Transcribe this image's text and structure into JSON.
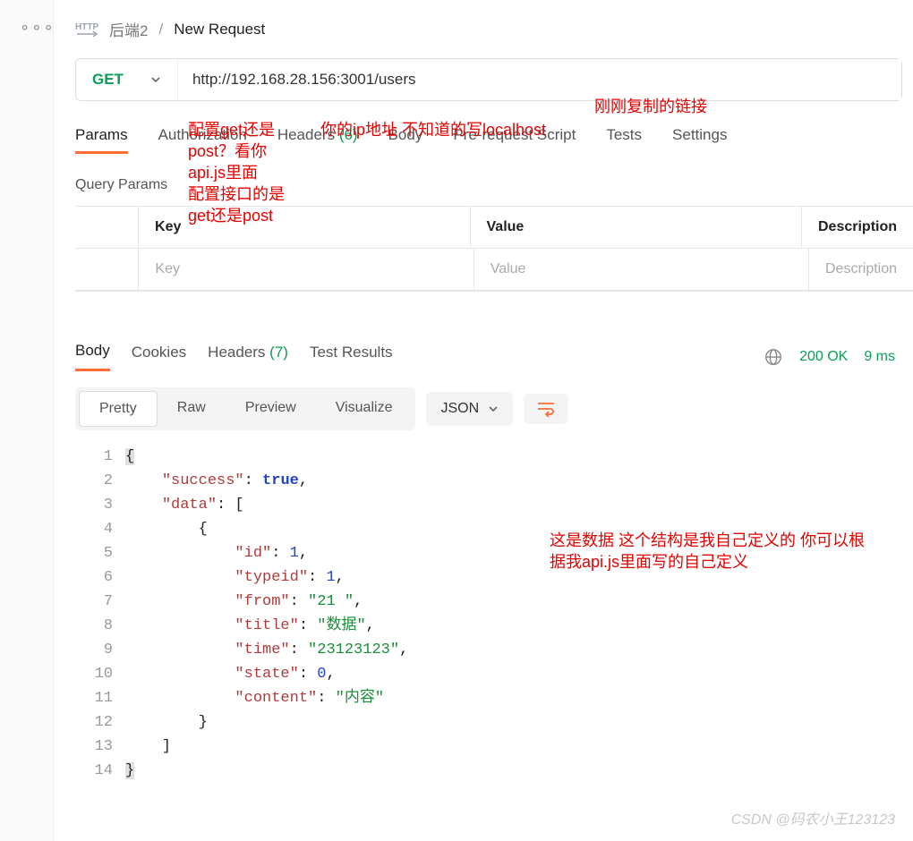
{
  "sidebar": {
    "menu_glyph": "∘∘∘"
  },
  "breadcrumb": {
    "http_badge": "HTTP",
    "parent": "后端2",
    "sep": "/",
    "title": "New Request"
  },
  "request": {
    "method": "GET",
    "url": "http://192.168.28.156:3001/users"
  },
  "req_tabs": {
    "params": "Params",
    "authorization": "Authorization",
    "headers_label": "Headers",
    "headers_count": "(6)",
    "body": "Body",
    "prerequest": "Pre-request Script",
    "tests": "Tests",
    "settings": "Settings"
  },
  "query_params": {
    "label": "Query Params",
    "headers": {
      "key": "Key",
      "value": "Value",
      "description": "Description"
    },
    "placeholders": {
      "key": "Key",
      "value": "Value",
      "description": "Description"
    }
  },
  "resp_tabs": {
    "body": "Body",
    "cookies": "Cookies",
    "headers_label": "Headers",
    "headers_count": "(7)",
    "test_results": "Test Results"
  },
  "status": {
    "code": "200 OK",
    "time": "9 ms"
  },
  "view": {
    "pretty": "Pretty",
    "raw": "Raw",
    "preview": "Preview",
    "visualize": "Visualize",
    "format": "JSON"
  },
  "json_body": {
    "success": true,
    "data_key": "data",
    "item": {
      "id": 1,
      "typeid": 1,
      "from": "21 ",
      "title": "数据",
      "time": "23123123",
      "state": 0,
      "content": "内容"
    }
  },
  "gutter_lines": [
    "1",
    "2",
    "3",
    "4",
    "5",
    "6",
    "7",
    "8",
    "9",
    "10",
    "11",
    "12",
    "13",
    "14"
  ],
  "annotations": {
    "method_note": "配置get还是\npost？看你\napi.js里面\n配置接口的是\nget还是post",
    "ip_note": "你的ip地址 不知道的写localhost",
    "link_note": "刚刚复制的链接",
    "data_note": "这是数据 这个结构是我自己定义的 你可以根\n据我api.js里面写的自己定义"
  },
  "watermark": "CSDN @码农小王123123"
}
